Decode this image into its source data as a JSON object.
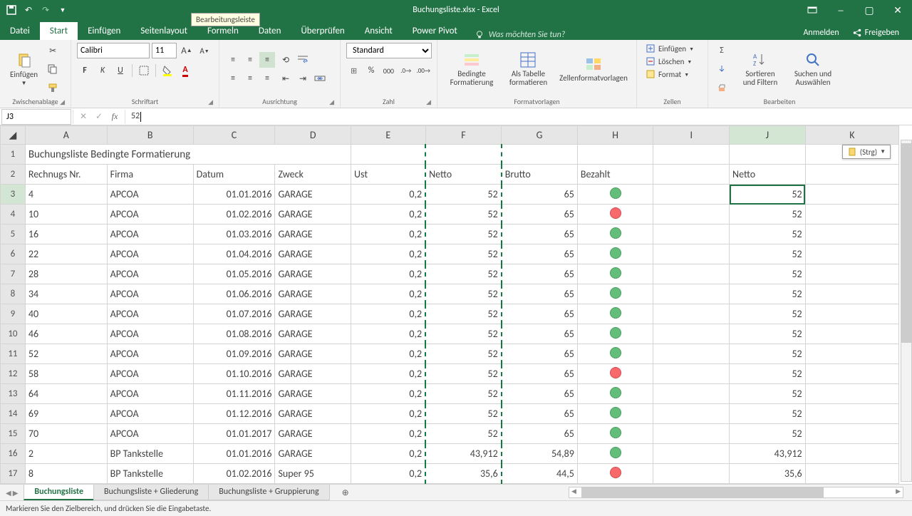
{
  "app": {
    "title": "Buchungsliste.xlsx - Excel",
    "file_tab": "Datei",
    "tabs": [
      "Start",
      "Einfügen",
      "Seitenlayout",
      "Formeln",
      "Daten",
      "Überprüfen",
      "Ansicht",
      "Power Pivot"
    ],
    "active_tab": 0,
    "tell_me_placeholder": "Was möchten Sie tun?",
    "sign_in": "Anmelden",
    "share": "Freigeben"
  },
  "ribbon": {
    "clipboard": {
      "paste": "Einfügen",
      "group": "Zwischenablage"
    },
    "font": {
      "name": "Calibri",
      "size": "11",
      "group": "Schriftart",
      "bold": "F",
      "italic": "K",
      "underline": "U"
    },
    "alignment": {
      "group": "Ausrichtung"
    },
    "number": {
      "format": "Standard",
      "group": "Zahl"
    },
    "styles": {
      "cond_fmt": "Bedingte Formatierung",
      "as_table": "Als Tabelle formatieren",
      "cell_styles": "Zellenformatvorlagen",
      "group": "Formatvorlagen"
    },
    "cells": {
      "insert": "Einfügen",
      "delete": "Löschen",
      "format": "Format",
      "group": "Zellen"
    },
    "editing": {
      "sort": "Sortieren und Filtern",
      "find": "Suchen und Auswählen",
      "group": "Bearbeiten"
    }
  },
  "formula_bar": {
    "name_box": "J3",
    "formula": "52",
    "tooltip": "Bearbeitungsleiste"
  },
  "paste_options_label": "(Strg)",
  "columns": [
    "A",
    "B",
    "C",
    "D",
    "E",
    "F",
    "G",
    "H",
    "I",
    "J",
    "K"
  ],
  "row1_title": "Buchungsliste Bedingte Formatierung",
  "headers": {
    "A": "Rechnugs Nr.",
    "B": "Firma",
    "C": "Datum",
    "D": "Zweck",
    "E": "Ust",
    "F": "Netto",
    "G": "Brutto",
    "H": "Bezahlt",
    "I": "",
    "J": "Netto",
    "K": ""
  },
  "rows": [
    {
      "r": 3,
      "A": "4",
      "B": "APCOA",
      "C": "01.01.2016",
      "D": "GARAGE",
      "E": "0,2",
      "F": "52",
      "G": "65",
      "H": "green",
      "J": "52"
    },
    {
      "r": 4,
      "A": "10",
      "B": "APCOA",
      "C": "01.02.2016",
      "D": "GARAGE",
      "E": "0,2",
      "F": "52",
      "G": "65",
      "H": "red",
      "J": "52"
    },
    {
      "r": 5,
      "A": "16",
      "B": "APCOA",
      "C": "01.03.2016",
      "D": "GARAGE",
      "E": "0,2",
      "F": "52",
      "G": "65",
      "H": "green",
      "J": "52"
    },
    {
      "r": 6,
      "A": "22",
      "B": "APCOA",
      "C": "01.04.2016",
      "D": "GARAGE",
      "E": "0,2",
      "F": "52",
      "G": "65",
      "H": "green",
      "J": "52"
    },
    {
      "r": 7,
      "A": "28",
      "B": "APCOA",
      "C": "01.05.2016",
      "D": "GARAGE",
      "E": "0,2",
      "F": "52",
      "G": "65",
      "H": "green",
      "J": "52"
    },
    {
      "r": 8,
      "A": "34",
      "B": "APCOA",
      "C": "01.06.2016",
      "D": "GARAGE",
      "E": "0,2",
      "F": "52",
      "G": "65",
      "H": "green",
      "J": "52"
    },
    {
      "r": 9,
      "A": "40",
      "B": "APCOA",
      "C": "01.07.2016",
      "D": "GARAGE",
      "E": "0,2",
      "F": "52",
      "G": "65",
      "H": "green",
      "J": "52"
    },
    {
      "r": 10,
      "A": "46",
      "B": "APCOA",
      "C": "01.08.2016",
      "D": "GARAGE",
      "E": "0,2",
      "F": "52",
      "G": "65",
      "H": "green",
      "J": "52"
    },
    {
      "r": 11,
      "A": "52",
      "B": "APCOA",
      "C": "01.09.2016",
      "D": "GARAGE",
      "E": "0,2",
      "F": "52",
      "G": "65",
      "H": "green",
      "J": "52"
    },
    {
      "r": 12,
      "A": "58",
      "B": "APCOA",
      "C": "01.10.2016",
      "D": "GARAGE",
      "E": "0,2",
      "F": "52",
      "G": "65",
      "H": "red",
      "J": "52"
    },
    {
      "r": 13,
      "A": "64",
      "B": "APCOA",
      "C": "01.11.2016",
      "D": "GARAGE",
      "E": "0,2",
      "F": "52",
      "G": "65",
      "H": "green",
      "J": "52"
    },
    {
      "r": 14,
      "A": "69",
      "B": "APCOA",
      "C": "01.12.2016",
      "D": "GARAGE",
      "E": "0,2",
      "F": "52",
      "G": "65",
      "H": "green",
      "J": "52"
    },
    {
      "r": 15,
      "A": "70",
      "B": "APCOA",
      "C": "01.01.2017",
      "D": "GARAGE",
      "E": "0,2",
      "F": "52",
      "G": "65",
      "H": "green",
      "J": "52"
    },
    {
      "r": 16,
      "A": "2",
      "B": "BP Tankstelle",
      "C": "01.01.2016",
      "D": "GARAGE",
      "E": "0,2",
      "F": "43,912",
      "G": "54,89",
      "H": "green",
      "J": "43,912"
    },
    {
      "r": 17,
      "A": "8",
      "B": "BP Tankstelle",
      "C": "01.02.2016",
      "D": "Super 95",
      "E": "0,2",
      "F": "35,6",
      "G": "44,5",
      "H": "red",
      "J": "35,6"
    }
  ],
  "sheet_tabs": [
    "Buchungsliste",
    "Buchungsliste + Gliederung",
    "Buchungsliste + Gruppierung"
  ],
  "active_sheet": 0,
  "status_text": "Markieren Sie den Zielbereich, und drücken Sie die Eingabetaste."
}
